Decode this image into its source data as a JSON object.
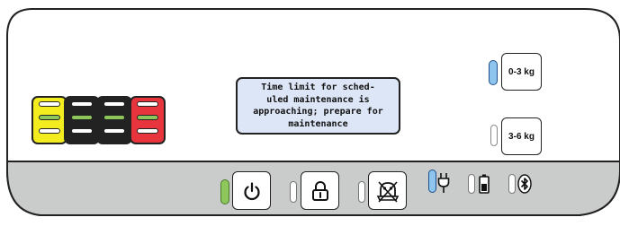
{
  "message": "Time limit for sched-\nuled maintenance is\napproaching; prepare for\nmaintenance",
  "load_options": [
    {
      "label": "0-3 kg",
      "indicator": "active",
      "indicator_color": "#8ec5ee"
    },
    {
      "label": "3-6 kg",
      "indicator": "inactive",
      "indicator_color": "#ffffff"
    }
  ],
  "level_bars": [
    {
      "color": "#f3ec1e",
      "segments": [
        "off",
        "on",
        "off"
      ]
    },
    {
      "color": "#222222",
      "segments": [
        "off",
        "on",
        "off"
      ]
    },
    {
      "color": "#222222",
      "segments": [
        "off",
        "on",
        "off"
      ]
    },
    {
      "color": "#e8343d",
      "segments": [
        "off",
        "on",
        "off"
      ]
    }
  ],
  "colors": {
    "segment_on": "#8dc65a",
    "segment_off": "#ffffff",
    "panel_gray": "#c9cccb",
    "message_bg": "#dde6f6"
  },
  "buttons": [
    {
      "name": "power",
      "icon": "power-icon",
      "indicator_color": "#8dc65a"
    },
    {
      "name": "lock",
      "icon": "lock-icon",
      "indicator_color": "#ffffff"
    },
    {
      "name": "maintenance-off",
      "icon": "maintenance-crossed-icon",
      "indicator_color": "#ffffff"
    }
  ],
  "status_icons": [
    {
      "name": "power-plug",
      "icon": "plug-icon",
      "indicator_color": "#8ec5ee"
    },
    {
      "name": "battery",
      "icon": "battery-icon",
      "indicator_color": "#ffffff"
    },
    {
      "name": "bluetooth",
      "icon": "bluetooth-icon",
      "indicator_color": "#ffffff"
    }
  ]
}
